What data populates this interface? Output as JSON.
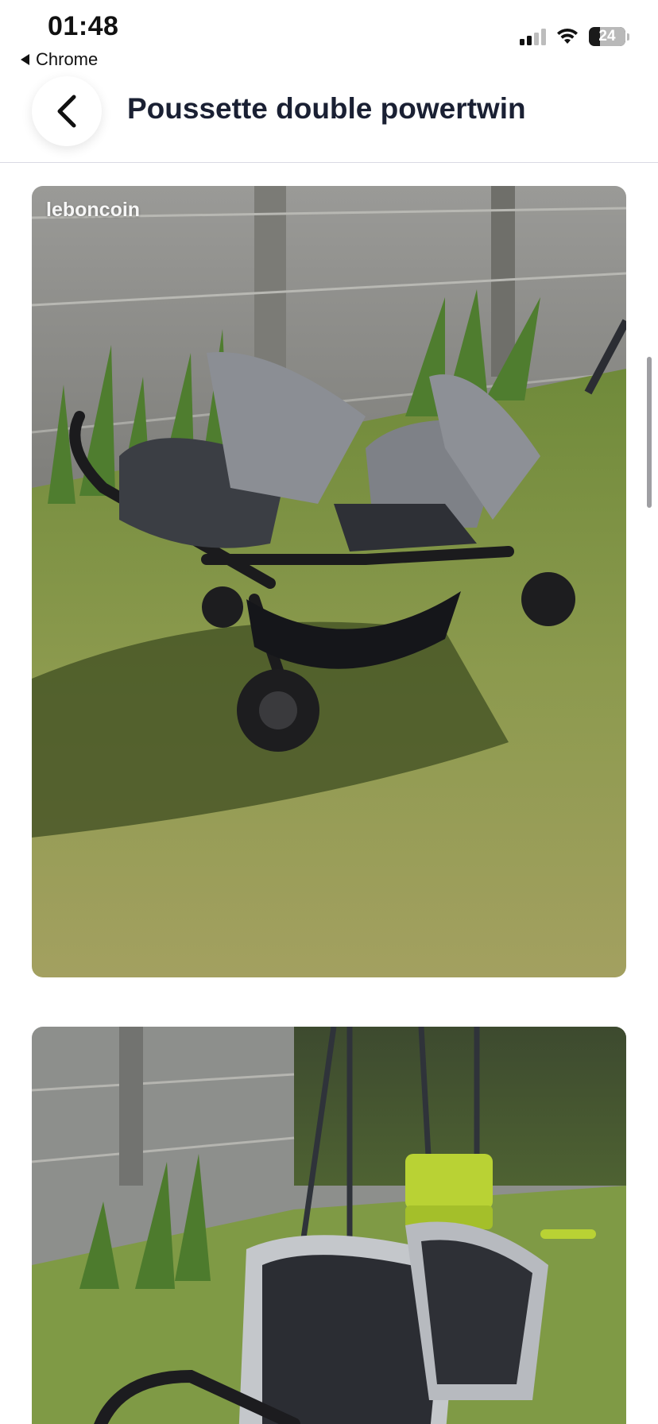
{
  "status_bar": {
    "time": "01:48",
    "back_app_label": "Chrome",
    "battery_level": "24",
    "signal_icon": "cellular-signal-icon",
    "wifi_icon": "wifi-icon"
  },
  "header": {
    "back_icon": "chevron-left-icon",
    "title": "Poussette double powertwin"
  },
  "gallery": {
    "photos": [
      {
        "watermark": "leboncoin",
        "description": "double-stroller-on-grass"
      },
      {
        "description": "double-stroller-near-swings"
      }
    ]
  },
  "colors": {
    "title": "#1a2033",
    "divider": "#d9d9e3",
    "background": "#ffffff"
  }
}
